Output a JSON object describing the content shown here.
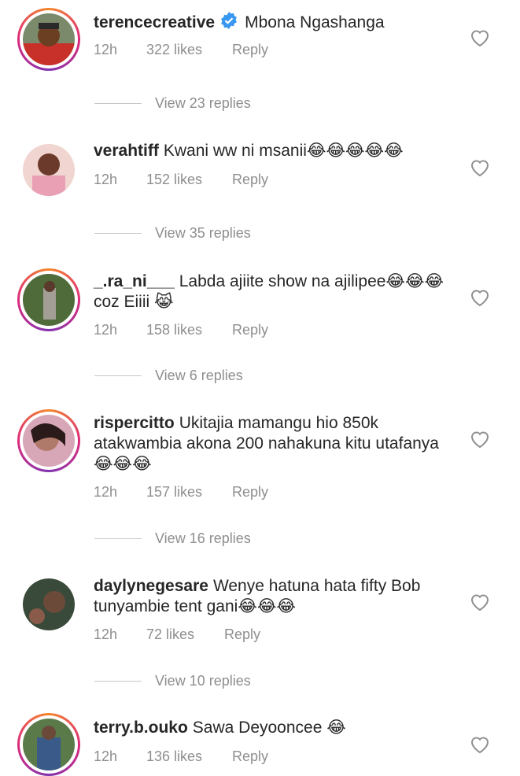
{
  "comments": [
    {
      "username": "terencecreative",
      "verified": true,
      "text": "Mbona Ngashanga",
      "time": "12h",
      "likes": "322 likes",
      "reply": "Reply",
      "view_replies": "View 23 replies",
      "story": true
    },
    {
      "username": "verahtiff",
      "verified": false,
      "text": "Kwani ww ni msanii😂😂😂😂😂",
      "time": "12h",
      "likes": "152 likes",
      "reply": "Reply",
      "view_replies": "View 35 replies",
      "story": false
    },
    {
      "username": "_.ra_ni___",
      "verified": false,
      "text": "Labda ajiite show  na ajilipee😂😂😂coz Eiiii 😹",
      "time": "12h",
      "likes": "158 likes",
      "reply": "Reply",
      "view_replies": "View 6 replies",
      "story": true
    },
    {
      "username": "rispercitto",
      "verified": false,
      "text": "Ukitajia mamangu hio 850k atakwambia akona 200 nahakuna kitu utafanya😂😂😂",
      "time": "12h",
      "likes": "157 likes",
      "reply": "Reply",
      "view_replies": "View 16 replies",
      "story": true
    },
    {
      "username": "daylynegesare",
      "verified": false,
      "text": "Wenye hatuna hata fifty Bob tunyambie tent gani😂😂😂",
      "time": "12h",
      "likes": "72 likes",
      "reply": "Reply",
      "view_replies": "View 10 replies",
      "story": false
    },
    {
      "username": "terry.b.ouko",
      "verified": false,
      "text": "Sawa Deyooncee 😂",
      "time": "12h",
      "likes": "136 likes",
      "reply": "Reply",
      "view_replies": "",
      "story": true
    }
  ],
  "colors": {
    "text": "#262626",
    "meta": "#8e8e8e",
    "verified": "#3897f0",
    "story_ring_start": "#f58529",
    "story_ring_end": "#dd2a7b"
  },
  "icons": {
    "verified": "verified-badge-icon",
    "like": "heart-outline-icon"
  }
}
